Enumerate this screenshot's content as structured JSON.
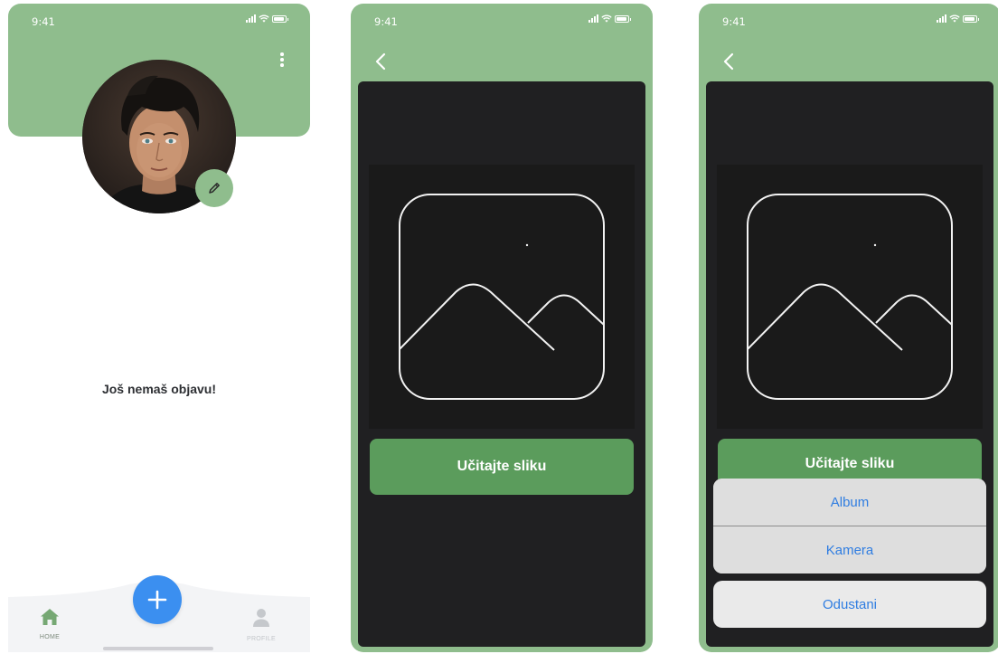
{
  "status_bar": {
    "time": "9:41"
  },
  "profile_screen": {
    "empty_message": "Još nemaš objavu!",
    "nav": {
      "home_label": "HOME",
      "profile_label": "PROFILE"
    }
  },
  "upload_screen": {
    "upload_button_label": "Učitajte sliku"
  },
  "action_sheet": {
    "options": [
      "Album",
      "Kamera"
    ],
    "cancel_label": "Odustani"
  },
  "colors": {
    "accent_green": "#8fbd8d",
    "button_green": "#5b9c5c",
    "fab_blue": "#3b8ff0",
    "dark_background": "#202022",
    "action_blue": "#2f7de1"
  }
}
